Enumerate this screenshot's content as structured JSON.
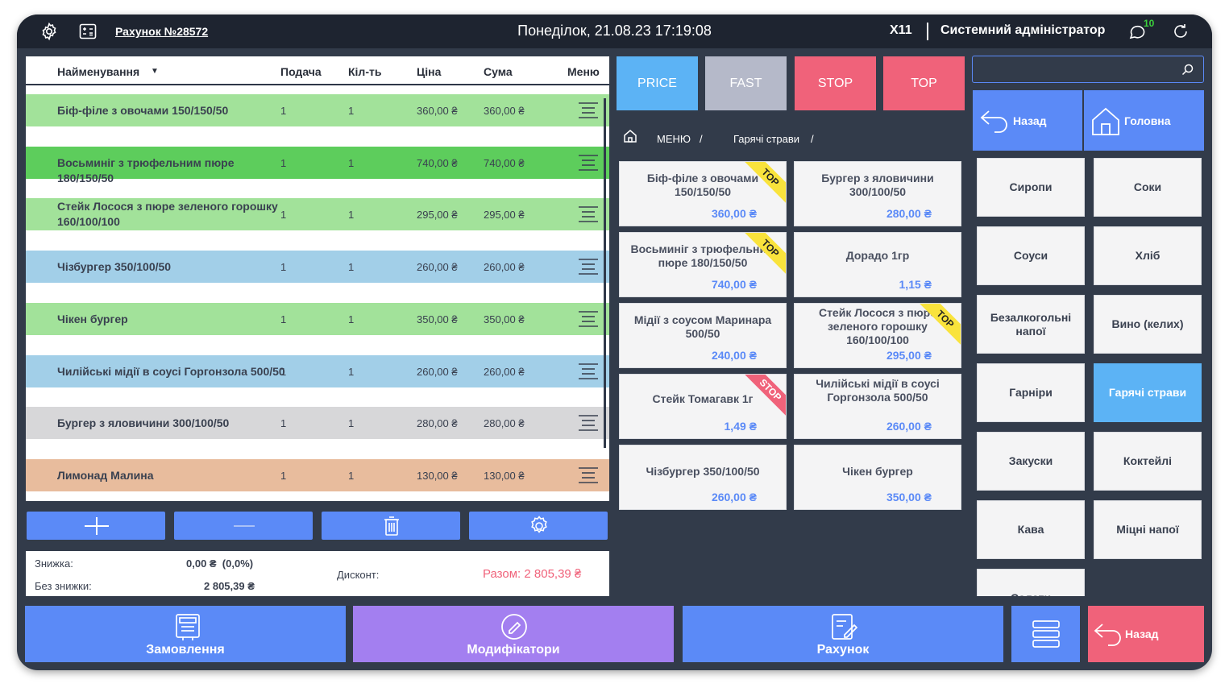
{
  "header": {
    "bill_label": "Рахунок №28572",
    "datetime": "Понеділок, 21.08.23 17:19:08",
    "table": "X11",
    "user": "Системний адміністратор",
    "notification_count": "10"
  },
  "order": {
    "columns": {
      "name": "Найменування",
      "serve": "Подача",
      "qty": "Кіл-ть",
      "price": "Ціна",
      "sum": "Сума",
      "menu": "Меню"
    },
    "rows": [
      {
        "name": "Біф-філе з овочами 150/150/50",
        "serve": "1",
        "qty": "1",
        "price": "360,00 ₴",
        "sum": "360,00 ₴",
        "color": "#a2e29a"
      },
      {
        "name": "Восьминіг з трюфельним пюре 180/150/50",
        "serve": "1",
        "qty": "1",
        "price": "740,00 ₴",
        "sum": "740,00 ₴",
        "color": "#5dcd5c"
      },
      {
        "name": "Стейк Лосося з пюре зеленого горошку 160/100/100",
        "serve": "1",
        "qty": "1",
        "price": "295,00 ₴",
        "sum": "295,00 ₴",
        "color": "#a2e29a"
      },
      {
        "name": "Чізбургер 350/100/50",
        "serve": "1",
        "qty": "1",
        "price": "260,00 ₴",
        "sum": "260,00 ₴",
        "color": "#a2cfe8"
      },
      {
        "name": "Чікен бургер",
        "serve": "1",
        "qty": "1",
        "price": "350,00 ₴",
        "sum": "350,00 ₴",
        "color": "#a2e29a"
      },
      {
        "name": "Чилійські мідії в соусі Горгонзола 500/50",
        "serve": "1",
        "qty": "1",
        "price": "260,00 ₴",
        "sum": "260,00 ₴",
        "color": "#a2cfe8"
      },
      {
        "name": "Бургер з яловичини 300/100/50",
        "serve": "1",
        "qty": "1",
        "price": "280,00 ₴",
        "sum": "280,00 ₴",
        "color": "#d7d7d9"
      },
      {
        "name": "Лимонад Малина",
        "serve": "1",
        "qty": "1",
        "price": "130,00 ₴",
        "sum": "130,00 ₴",
        "color": "#e8bc9d"
      }
    ]
  },
  "totals": {
    "discount_label": "Знижка:",
    "discount_value": "0,00 ₴  (0,0%)",
    "no_discount_label": "Без знижки:",
    "no_discount_value": "2 805,39 ₴",
    "card_label": "Дисконт:",
    "total": "Разом: 2 805,39 ₴"
  },
  "filters": [
    "PRICE",
    "FAST",
    "STOP",
    "TOP"
  ],
  "breadcrumb": [
    "МЕНЮ",
    "/",
    "Гарячі страви",
    "/"
  ],
  "tiles": [
    {
      "name": "Біф-філе з овочами 150/150/50",
      "price": "360,00 ₴",
      "tag": "TOP"
    },
    {
      "name": "Бургер з яловичини 300/100/50",
      "price": "280,00 ₴",
      "tag": ""
    },
    {
      "name": "Восьминіг з трюфельним пюре 180/150/50",
      "price": "740,00 ₴",
      "tag": "TOP"
    },
    {
      "name": "Дорадо 1гр",
      "price": "1,15 ₴",
      "tag": ""
    },
    {
      "name": "Мідії з соусом Маринара 500/50",
      "price": "240,00 ₴",
      "tag": ""
    },
    {
      "name": "Стейк Лосося з пюре зеленого горошку 160/100/100",
      "price": "295,00 ₴",
      "tag": "TOP"
    },
    {
      "name": "Стейк Томагавк 1г",
      "price": "1,49 ₴",
      "tag": "STOP"
    },
    {
      "name": "Чилійські мідії в соусі Горгонзола 500/50",
      "price": "260,00 ₴",
      "tag": ""
    },
    {
      "name": "Чізбургер 350/100/50",
      "price": "260,00 ₴",
      "tag": ""
    },
    {
      "name": "Чікен бургер",
      "price": "350,00 ₴",
      "tag": ""
    }
  ],
  "nav": {
    "back": "Назад",
    "home": "Головна"
  },
  "categories": [
    "Сиропи",
    "Соки",
    "Соуси",
    "Хліб",
    "Безалкогольні напої",
    "Вино (келих)",
    "Гарніри",
    "Гарячі страви",
    "Закуски",
    "Коктейлі",
    "Кава",
    "Міцні напої",
    "Салати"
  ],
  "active_category": "Гарячі страви",
  "bottom": {
    "orders": "Замовлення",
    "modifiers": "Модифікатори",
    "bill": "Рахунок",
    "back": "Назад"
  },
  "colors": {
    "accent": "#5b8af7",
    "purple": "#a37ff0",
    "stop": "#f0627a",
    "active": "#5cb3f5"
  }
}
